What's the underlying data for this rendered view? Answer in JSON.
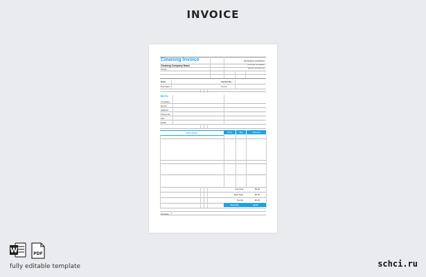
{
  "page": {
    "heading": "INVOICE"
  },
  "invoice": {
    "title": "Cleaning Invoice",
    "company_name": "Cleaning Company Name",
    "slogan": "Slogan",
    "address_lines": [
      "[BUSINESS ADDRESS]",
      "[PHONE NUMBER]",
      "[EMAIL ADDRESS]"
    ],
    "date_label": "Date:",
    "invoice_no_label": "Invoice No.:",
    "due_date_label": "Due Date:",
    "terms_label": "Terms:",
    "bill_to_label": "Bill To:",
    "bill_to_fields": [
      "Company:",
      "Name:",
      "Address:",
      "Phone No.:",
      "Fax:",
      "Email:"
    ],
    "table_headers": {
      "description": "Description",
      "cost": "Cost",
      "qty": "Qty",
      "amount": "Amount"
    },
    "totals": [
      {
        "label": "Sub Total",
        "value": "$0.00"
      },
      {
        "label": "Sales Rate",
        "value": "$0.00"
      },
      {
        "label": "Tax Dis",
        "value": "$0.00"
      }
    ],
    "total_due_label": "Total Due",
    "total_due_value": "$0.00",
    "signature_label": "Signature:"
  },
  "footer": {
    "word_icon": "word-icon",
    "pdf_icon": "pdf-icon",
    "pdf_text": "PDF",
    "word_text": "W",
    "caption": "fully editable template",
    "brand": "schci.ru"
  },
  "colors": {
    "accent": "#1aa3e8",
    "background": "#e9ebee"
  }
}
